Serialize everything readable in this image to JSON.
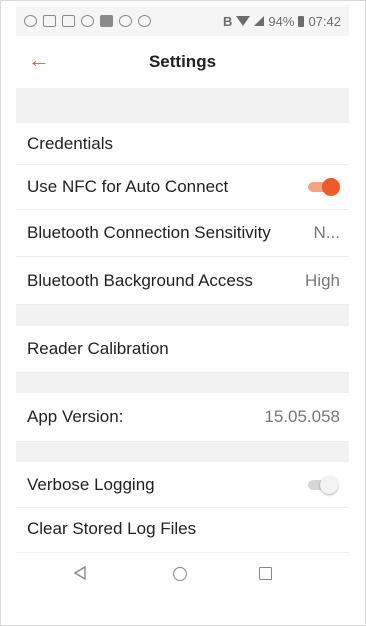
{
  "status_bar": {
    "bluetooth_indicator": "B",
    "battery_percent": "94%",
    "time": "07:42",
    "icons": [
      "search-icon",
      "screenshot-icon",
      "message-icon",
      "call-icon",
      "gallery-icon",
      "network-icon",
      "notification-icon",
      "signal-icon",
      "wifi-icon",
      "battery-icon"
    ]
  },
  "app_bar": {
    "back_icon": "←",
    "title": "Settings"
  },
  "settings": {
    "credentials": "Credentials",
    "nfc_label": "Use NFC for Auto Connect",
    "nfc_enabled": true,
    "bt_sensitivity_label": "Bluetooth Connection Sensitivity",
    "bt_sensitivity_value": "N...",
    "bt_background_label": "Bluetooth Background Access",
    "bt_background_value": "High",
    "reader_calibration": "Reader Calibration",
    "app_version_label": "App Version:",
    "app_version_value": "15.05.058",
    "verbose_logging_label": "Verbose Logging",
    "verbose_logging_enabled": false,
    "clear_logs": "Clear Stored Log Files"
  },
  "colors": {
    "accent": "#f05a28",
    "section_gap": "#f2f2f2"
  },
  "nav_bar": {
    "icons": [
      "back-nav-icon",
      "home-nav-icon",
      "recents-nav-icon"
    ]
  }
}
